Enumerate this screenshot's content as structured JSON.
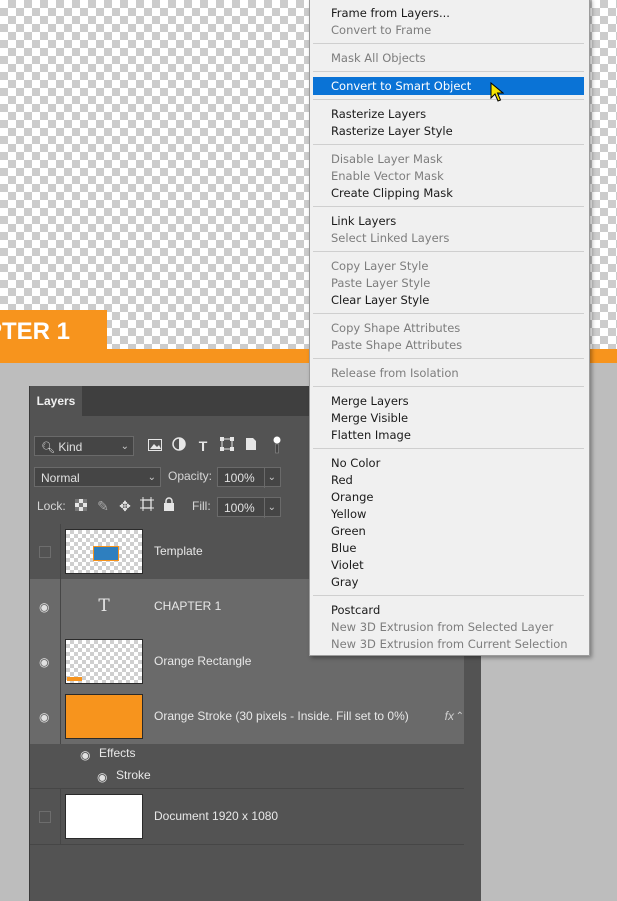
{
  "canvas": {
    "chapter_text": "PTER 1"
  },
  "layers_panel": {
    "tab": "Layers",
    "filter": {
      "kind": "Kind"
    },
    "blend_mode": "Normal",
    "opacity_label": "Opacity:",
    "opacity_value": "100%",
    "lock_label": "Lock:",
    "fill_label": "Fill:",
    "fill_value": "100%",
    "layers": [
      {
        "name": "Template"
      },
      {
        "name": "CHAPTER 1",
        "type_icon": "T"
      },
      {
        "name": "Orange Rectangle"
      },
      {
        "name": "Orange Stroke (30 pixels - Inside. Fill set to 0%)",
        "fx": "fx"
      },
      {
        "name": "Document 1920 x 1080"
      }
    ],
    "effects_label": "Effects",
    "stroke_label": "Stroke"
  },
  "context_menu": {
    "items": [
      {
        "label": "Frame from Layers...",
        "state": "enabled"
      },
      {
        "label": "Convert to Frame",
        "state": "disabled"
      },
      {
        "label": "Mask All Objects",
        "state": "disabled"
      },
      {
        "label": "Convert to Smart Object",
        "state": "highlighted"
      },
      {
        "label": "Rasterize Layers",
        "state": "enabled"
      },
      {
        "label": "Rasterize Layer Style",
        "state": "enabled"
      },
      {
        "label": "Disable Layer Mask",
        "state": "disabled"
      },
      {
        "label": "Enable Vector Mask",
        "state": "disabled"
      },
      {
        "label": "Create Clipping Mask",
        "state": "enabled"
      },
      {
        "label": "Link Layers",
        "state": "enabled"
      },
      {
        "label": "Select Linked Layers",
        "state": "disabled"
      },
      {
        "label": "Copy Layer Style",
        "state": "disabled"
      },
      {
        "label": "Paste Layer Style",
        "state": "disabled"
      },
      {
        "label": "Clear Layer Style",
        "state": "enabled"
      },
      {
        "label": "Copy Shape Attributes",
        "state": "disabled"
      },
      {
        "label": "Paste Shape Attributes",
        "state": "disabled"
      },
      {
        "label": "Release from Isolation",
        "state": "disabled"
      },
      {
        "label": "Merge Layers",
        "state": "enabled"
      },
      {
        "label": "Merge Visible",
        "state": "enabled"
      },
      {
        "label": "Flatten Image",
        "state": "enabled"
      },
      {
        "label": "No Color",
        "state": "enabled"
      },
      {
        "label": "Red",
        "state": "enabled"
      },
      {
        "label": "Orange",
        "state": "enabled"
      },
      {
        "label": "Yellow",
        "state": "enabled"
      },
      {
        "label": "Green",
        "state": "enabled"
      },
      {
        "label": "Blue",
        "state": "enabled"
      },
      {
        "label": "Violet",
        "state": "enabled"
      },
      {
        "label": "Gray",
        "state": "enabled"
      },
      {
        "label": "Postcard",
        "state": "enabled"
      },
      {
        "label": "New 3D Extrusion from Selected Layer",
        "state": "disabled"
      },
      {
        "label": "New 3D Extrusion from Current Selection",
        "state": "disabled"
      }
    ]
  },
  "colors": {
    "accent_orange": "#f7941d",
    "menu_highlight": "#0a73d6",
    "panel_bg": "#535353"
  }
}
